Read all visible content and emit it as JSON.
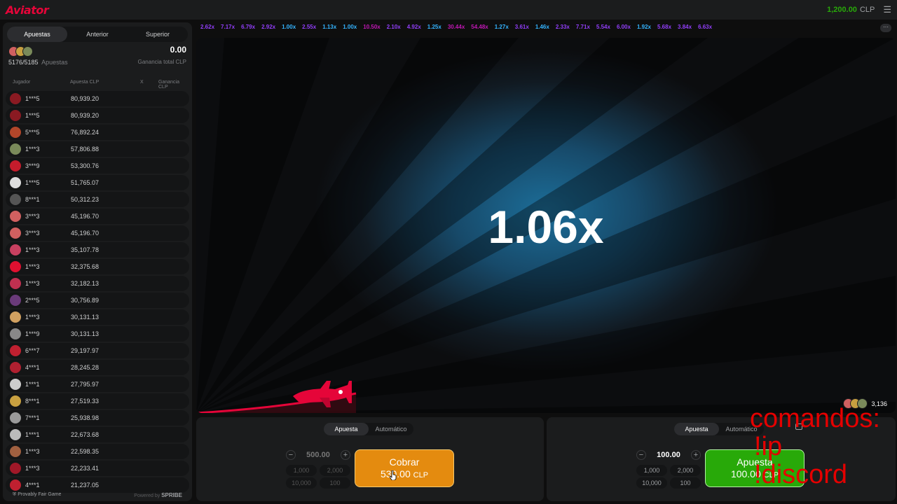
{
  "topbar": {
    "logo": "Aviator",
    "balance": "1,200.00",
    "currency": "CLP",
    "menu_icon": "hamburger-icon"
  },
  "left_panel": {
    "tabs": [
      {
        "label": "Apuestas",
        "active": true
      },
      {
        "label": "Anterior",
        "active": false
      },
      {
        "label": "Superior",
        "active": false
      }
    ],
    "count": "5176/5185",
    "count_label": "Apuestas",
    "total": "0.00",
    "total_label": "Ganancia total CLP",
    "columns": {
      "player": "Jugador",
      "bet": "Apuesta CLP",
      "x": "X",
      "win": "Ganancia CLP"
    },
    "rows": [
      {
        "name": "1***5",
        "bet": "80,939.20",
        "color": "#8a1a22"
      },
      {
        "name": "1***5",
        "bet": "80,939.20",
        "color": "#8a1a22"
      },
      {
        "name": "5***5",
        "bet": "76,892.24",
        "color": "#b2462a"
      },
      {
        "name": "1***3",
        "bet": "57,806.88",
        "color": "#7a8a5a"
      },
      {
        "name": "3***9",
        "bet": "53,300.76",
        "color": "#c41c2c"
      },
      {
        "name": "1***5",
        "bet": "51,765.07",
        "color": "#dddddd"
      },
      {
        "name": "8***1",
        "bet": "50,312.23",
        "color": "#555555"
      },
      {
        "name": "3***3",
        "bet": "45,196.70",
        "color": "#d06060"
      },
      {
        "name": "3***3",
        "bet": "45,196.70",
        "color": "#d06060"
      },
      {
        "name": "1***3",
        "bet": "35,107.78",
        "color": "#c84060"
      },
      {
        "name": "1***3",
        "bet": "32,375.68",
        "color": "#e01030"
      },
      {
        "name": "1***3",
        "bet": "32,182.13",
        "color": "#c03050"
      },
      {
        "name": "2***5",
        "bet": "30,756.89",
        "color": "#6a3a7a"
      },
      {
        "name": "1***3",
        "bet": "30,131.13",
        "color": "#d0a060"
      },
      {
        "name": "1***9",
        "bet": "30,131.13",
        "color": "#888888"
      },
      {
        "name": "6***7",
        "bet": "29,197.97",
        "color": "#c02030"
      },
      {
        "name": "4***1",
        "bet": "28,245.28",
        "color": "#b02030"
      },
      {
        "name": "1***1",
        "bet": "27,795.97",
        "color": "#cccccc"
      },
      {
        "name": "8***1",
        "bet": "27,519.33",
        "color": "#c8a040"
      },
      {
        "name": "7***1",
        "bet": "25,938.98",
        "color": "#9a9a9a"
      },
      {
        "name": "1***1",
        "bet": "22,673.68",
        "color": "#bbbbbb"
      },
      {
        "name": "1***3",
        "bet": "22,598.35",
        "color": "#a06040"
      },
      {
        "name": "1***3",
        "bet": "22,233.41",
        "color": "#a01828"
      },
      {
        "name": "4***1",
        "bet": "21,237.05",
        "color": "#c02030"
      }
    ],
    "footer_left": "Provably Fair Game",
    "footer_powered": "Powered by",
    "footer_brand": "SPRIBE"
  },
  "history": [
    {
      "v": "2.62x",
      "c": "#913ef8"
    },
    {
      "v": "7.17x",
      "c": "#913ef8"
    },
    {
      "v": "6.79x",
      "c": "#913ef8"
    },
    {
      "v": "2.92x",
      "c": "#913ef8"
    },
    {
      "v": "1.00x",
      "c": "#34b4ff"
    },
    {
      "v": "2.55x",
      "c": "#913ef8"
    },
    {
      "v": "1.13x",
      "c": "#34b4ff"
    },
    {
      "v": "1.00x",
      "c": "#34b4ff"
    },
    {
      "v": "10.50x",
      "c": "#c017b4"
    },
    {
      "v": "2.10x",
      "c": "#913ef8"
    },
    {
      "v": "4.92x",
      "c": "#913ef8"
    },
    {
      "v": "1.25x",
      "c": "#34b4ff"
    },
    {
      "v": "30.44x",
      "c": "#c017b4"
    },
    {
      "v": "54.48x",
      "c": "#c017b4"
    },
    {
      "v": "1.27x",
      "c": "#34b4ff"
    },
    {
      "v": "3.61x",
      "c": "#913ef8"
    },
    {
      "v": "1.46x",
      "c": "#34b4ff"
    },
    {
      "v": "2.33x",
      "c": "#913ef8"
    },
    {
      "v": "7.71x",
      "c": "#913ef8"
    },
    {
      "v": "5.54x",
      "c": "#913ef8"
    },
    {
      "v": "6.00x",
      "c": "#913ef8"
    },
    {
      "v": "1.92x",
      "c": "#34b4ff"
    },
    {
      "v": "5.68x",
      "c": "#913ef8"
    },
    {
      "v": "3.84x",
      "c": "#913ef8"
    },
    {
      "v": "6.63x",
      "c": "#913ef8"
    }
  ],
  "history_more_icon": "ellipsis-icon",
  "game": {
    "multiplier": "1.06x",
    "online_count": "3,136"
  },
  "bet1": {
    "tabs": [
      "Apuesta",
      "Automático"
    ],
    "stake": "500.00",
    "chips": [
      "1,000",
      "2,000",
      "10,000",
      "100"
    ],
    "button_l1": "Cobrar",
    "button_amount": "530.00",
    "button_currency": "CLP"
  },
  "bet2": {
    "tabs": [
      "Apuesta",
      "Automático"
    ],
    "stake": "100.00",
    "chips": [
      "1,000",
      "2,000",
      "10,000",
      "100"
    ],
    "button_l1": "Apuesta",
    "button_amount": "100.00",
    "button_currency": "CLP"
  },
  "overlay": {
    "line1": "comandos:",
    "line2": "!ip",
    "line3": "!discord"
  },
  "colors": {
    "accent_red": "#e50539",
    "green": "#28a909",
    "orange": "#e48b0f",
    "blue_mult": "#34b4ff",
    "purple_mult": "#913ef8",
    "magenta_mult": "#c017b4"
  }
}
